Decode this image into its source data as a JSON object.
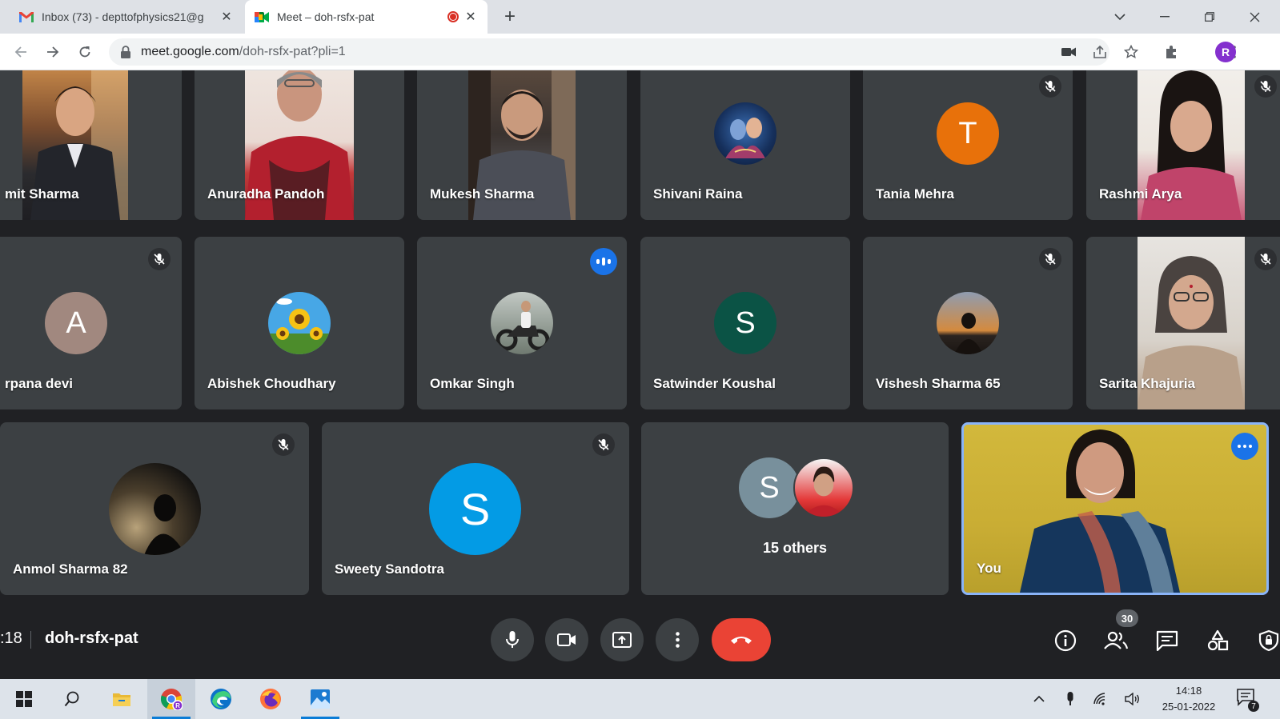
{
  "browser": {
    "tabs": [
      {
        "title": "Inbox (73) - depttofphysics21@g",
        "icon": "gmail-icon"
      },
      {
        "title": "Meet – doh-rsfx-pat",
        "icon": "meet-icon",
        "recording": true
      }
    ],
    "url_host": "meet.google.com",
    "url_path": "/doh-rsfx-pat?pli=1",
    "profile_initial": "R",
    "profile_color": "#8430ce"
  },
  "participants": {
    "row1": [
      {
        "name": "mit Sharma",
        "type": "video"
      },
      {
        "name": "Anuradha Pandoh",
        "type": "video"
      },
      {
        "name": "Mukesh Sharma",
        "type": "video"
      },
      {
        "name": "Shivani Raina",
        "type": "avatar-image"
      },
      {
        "name": "Tania Mehra",
        "type": "avatar-letter",
        "letter": "T",
        "color": "#e8710a",
        "muted": true
      },
      {
        "name": "Rashmi Arya",
        "type": "video",
        "muted": true
      }
    ],
    "row2": [
      {
        "name": "rpana devi",
        "type": "avatar-letter",
        "letter": "A",
        "color": "#a1887f",
        "muted": true
      },
      {
        "name": "Abishek Choudhary",
        "type": "avatar-image"
      },
      {
        "name": "Omkar Singh",
        "type": "avatar-image",
        "speaking": true
      },
      {
        "name": "Satwinder Koushal",
        "type": "avatar-letter",
        "letter": "S",
        "color": "#0b5345"
      },
      {
        "name": "Vishesh Sharma 65",
        "type": "avatar-image",
        "muted": true
      },
      {
        "name": "Sarita Khajuria",
        "type": "video",
        "muted": true
      }
    ],
    "row3": [
      {
        "name": "Anmol Sharma 82",
        "type": "avatar-image",
        "muted": true
      },
      {
        "name": "Sweety Sandotra",
        "type": "avatar-letter",
        "letter": "S",
        "color": "#039be5",
        "muted": true
      },
      {
        "name": "15 others",
        "type": "others",
        "letter": "S",
        "color": "#78909c"
      },
      {
        "name": "You",
        "type": "self-video"
      }
    ]
  },
  "meeting": {
    "time": ":18",
    "code": "doh-rsfx-pat",
    "people_count": "30",
    "end_color": "#ea4335",
    "accent": "#1a73e8"
  },
  "taskbar": {
    "time": "14:18",
    "date": "25-01-2022",
    "notifications": "7"
  }
}
